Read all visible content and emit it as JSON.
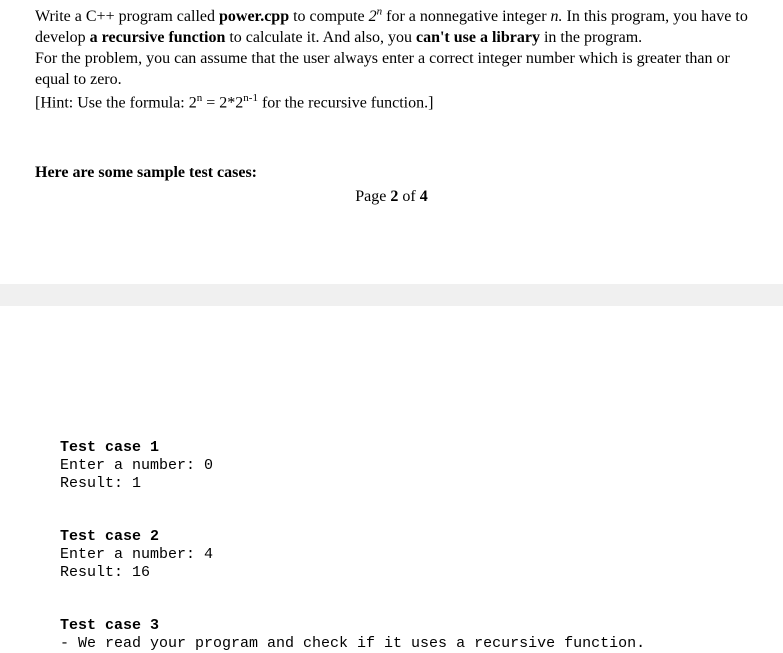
{
  "intro": {
    "prefix": "Write a C++ program called ",
    "filename": "power.cpp",
    "compute_text": " to compute ",
    "expr_base": "2",
    "expr_exp": "n",
    "for_text": " for a nonnegative integer ",
    "var_n": "n.",
    "in_this": " In this program, you have to develop ",
    "recursive": "a recursive function",
    "calc_text": " to calculate it. And also, you ",
    "cant_lib": "can't use a library",
    "in_program": " in the program.",
    "assume": "For the problem, you can assume that the user always enter a correct integer number which is greater than or equal to zero.",
    "hint_prefix": "[Hint: Use the formula: ",
    "hint_2": "2",
    "hint_n": "n",
    "hint_eq": " = 2*2",
    "hint_nm1": "n-1",
    "hint_suffix": " for the recursive function.]"
  },
  "sample_heading": "Here are some sample test cases:",
  "page_label_prefix": "Page ",
  "page_num": "2",
  "page_of": " of ",
  "page_total": "4",
  "testcases": {
    "tc1": {
      "title": "Test case 1",
      "prompt": "Enter a number: 0",
      "result": "Result: 1"
    },
    "tc2": {
      "title": "Test case 2",
      "prompt": "Enter a number: 4",
      "result": "Result: 16"
    },
    "tc3": {
      "title": "Test case 3",
      "desc": "- We read your program and check if it uses a recursive function."
    }
  }
}
